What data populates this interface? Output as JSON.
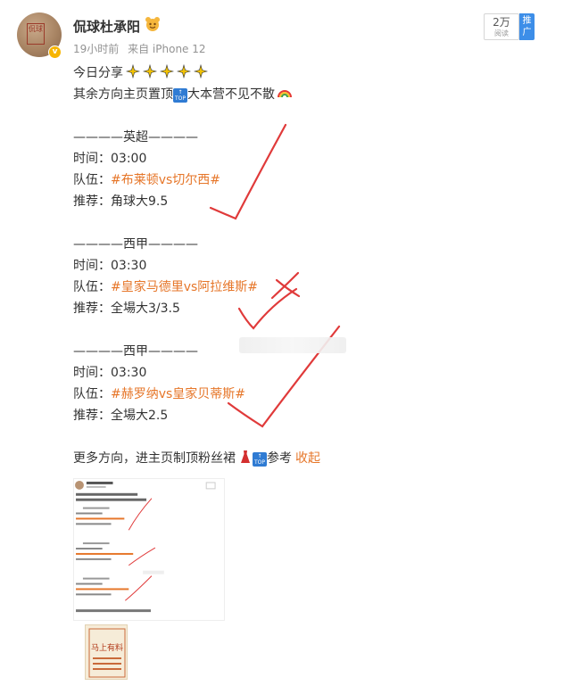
{
  "post": {
    "username": "侃球杜承阳",
    "time": "19小时前",
    "source": "来自 iPhone 12",
    "follow_count": "2万",
    "follow_sub": "阅读",
    "push_label": "推广",
    "intro_line1": "今日分享",
    "intro_line2": "其余方向主页置顶",
    "intro_line2_tail": "大本营不见不散",
    "matches": [
      {
        "league": "————英超————",
        "time_label": "时间：",
        "time": "03:00",
        "team_label": "队伍：",
        "teams": "#布莱顿vs切尔西#",
        "tip_label": "推荐：",
        "tip": "角球大9.5"
      },
      {
        "league": "————西甲————",
        "time_label": "时间：",
        "time": "03:30",
        "team_label": "队伍：",
        "teams": "#皇家马德里vs阿拉维斯#",
        "tip_label": "推荐：",
        "tip": "全場大3/3.5"
      },
      {
        "league": "————西甲————",
        "time_label": "时间：",
        "time": "03:30",
        "team_label": "队伍：",
        "teams": "#赫罗纳vs皇家贝蒂斯#",
        "tip_label": "推荐：",
        "tip": "全場大2.5"
      }
    ],
    "footer_text": "更多方向，进主页制顶粉丝裙",
    "footer_tail": "参考",
    "collapse_label": "收起",
    "avatar_seal": "侃球",
    "thumb_badge": "马上有料"
  },
  "colors": {
    "link": "#e67629",
    "text": "#333333",
    "meta": "#939393",
    "check": "#e03a3a",
    "push": "#3d8ee8"
  },
  "icons": [
    "sparkle-icon",
    "rainbow-icon",
    "top-icon",
    "dress-icon",
    "verified-icon",
    "red-check-mark"
  ]
}
